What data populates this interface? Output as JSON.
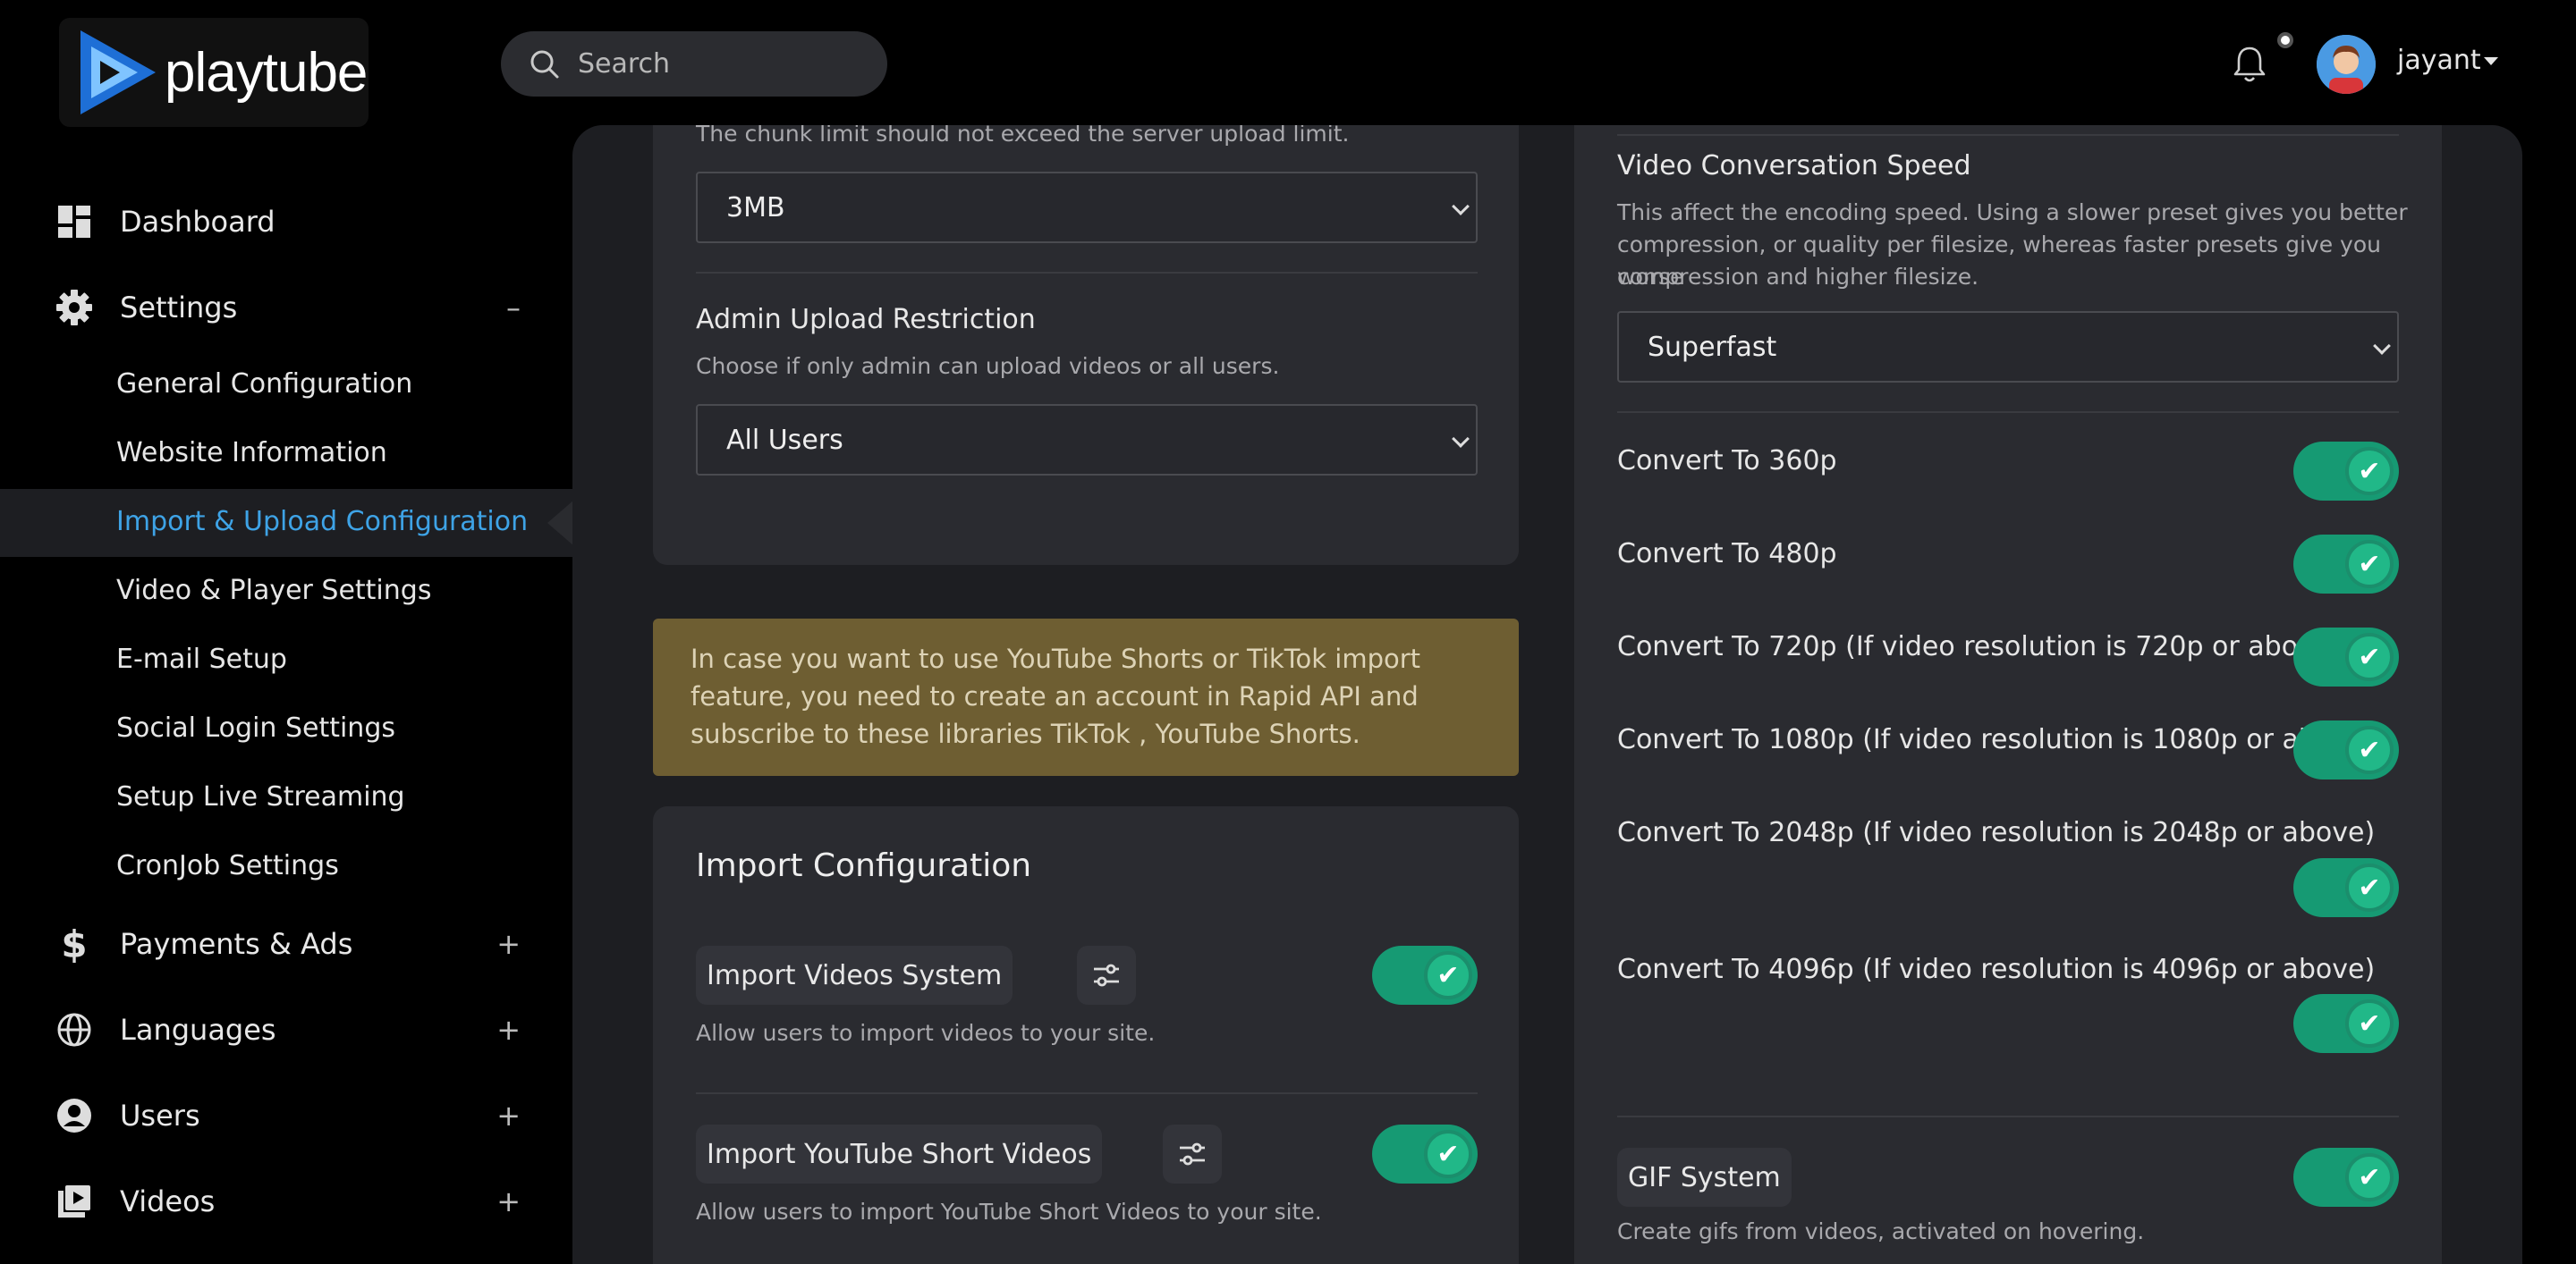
{
  "brand": {
    "name": "playtube"
  },
  "search": {
    "placeholder": "Search"
  },
  "user": {
    "name": "jayant"
  },
  "sidebar": {
    "dashboard": "Dashboard",
    "settings": "Settings",
    "settings_toggle": "–",
    "sub_items": [
      "General Configuration",
      "Website Information",
      "Import & Upload Configuration",
      "Video & Player Settings",
      "E-mail Setup",
      "Social Login Settings",
      "Setup Live Streaming",
      "CronJob Settings"
    ],
    "payments": "Payments & Ads",
    "languages": "Languages",
    "users": "Users",
    "videos": "Videos",
    "expand_symbol": "+"
  },
  "left_card": {
    "chunk_help": "The chunk limit should not exceed the server upload limit.",
    "chunk_value": "3MB",
    "admin_title": "Admin Upload Restriction",
    "admin_help": "Choose if only admin can upload videos or all users.",
    "admin_value": "All Users"
  },
  "notice": {
    "text": "In case you want to use YouTube Shorts or TikTok import feature, you need to create an account in Rapid API and subscribe to these libraries TikTok , YouTube Shorts."
  },
  "import_config": {
    "title": "Import Configuration",
    "videos_system": "Import Videos System",
    "videos_system_help": "Allow users to import videos to your site.",
    "yt_short": "Import YouTube Short Videos",
    "yt_short_help": "Allow users to import YouTube Short Videos to your site."
  },
  "right_card": {
    "speed_title": "Video Conversation Speed",
    "speed_help_1": "This affect the encoding speed. Using a slower preset gives you better",
    "speed_help_2": "compression, or quality per filesize, whereas faster presets give you worse",
    "speed_help_3": "compression and higher filesize.",
    "speed_value": "Superfast",
    "convert": [
      "Convert To 360p",
      "Convert To 480p",
      "Convert To 720p (If video resolution is 720p or above)",
      "Convert To 1080p (If video resolution is 1080p or above)",
      "Convert To 2048p (If video resolution is 2048p or above)",
      "Convert To 4096p (If video resolution is 4096p or above)"
    ],
    "gif_title": "GIF System",
    "gif_help": "Create gifs from videos, activated on hovering."
  },
  "toggle_check": "✔",
  "colors": {
    "accent": "#3ea3e6",
    "toggle_on": "#169a73",
    "notice_bg": "#6e5e32"
  }
}
